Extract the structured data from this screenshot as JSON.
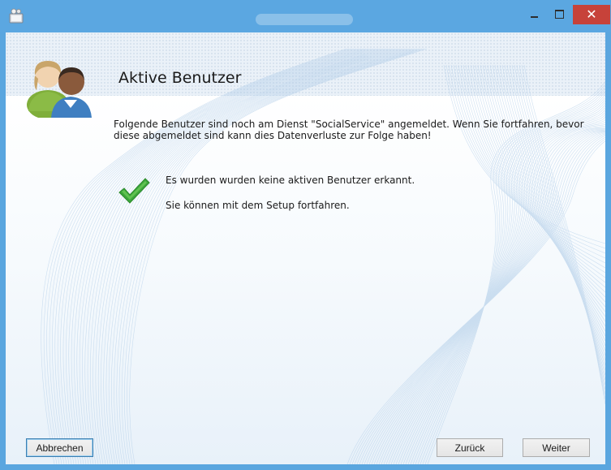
{
  "window": {
    "title": ""
  },
  "header": {
    "title": "Aktive Benutzer"
  },
  "main": {
    "description": "Folgende Benutzer sind noch am Dienst \"SocialService\" angemeldet. Wenn Sie fortfahren, bevor diese abgemeldet sind kann dies Datenverluste zur Folge haben!",
    "status_line_1": "Es wurden wurden keine aktiven Benutzer erkannt.",
    "status_line_2": "Sie können mit dem Setup fortfahren."
  },
  "footer": {
    "cancel_label": "Abbrechen",
    "back_label": "Zurück",
    "next_label": "Weiter"
  },
  "titlebar_buttons": {
    "close_glyph": "✕"
  },
  "colors": {
    "titlebar": "#5ba7e1",
    "close_button": "#c7423a",
    "check_green": "#3ca63c"
  },
  "icons": [
    "setup-app-icon",
    "users-icon",
    "check-icon",
    "minimize-icon",
    "maximize-icon",
    "close-icon"
  ]
}
